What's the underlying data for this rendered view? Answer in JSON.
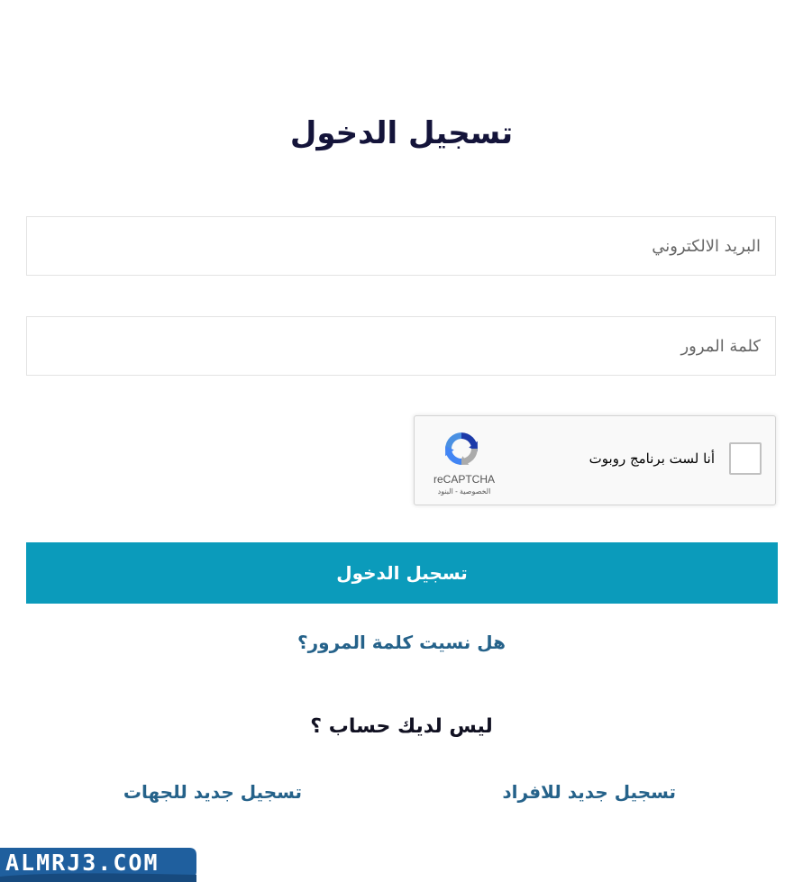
{
  "page": {
    "title": "تسجيل الدخول"
  },
  "form": {
    "email_placeholder": "البريد الالكتروني",
    "password_placeholder": "كلمة المرور",
    "login_button_label": "تسجيل الدخول"
  },
  "recaptcha": {
    "label": "أنا لست برنامج روبوت",
    "brand": "reCAPTCHA",
    "links": "الخصوصية - البنود",
    "logo_icon": "recaptcha-logo-icon",
    "checked": false
  },
  "links": {
    "forgot_password": "هل نسيت كلمة المرور؟",
    "no_account": "ليس لديك حساب ؟",
    "register_individuals": "تسجيل جديد للافراد",
    "register_entities": "تسجيل جديد للجهات"
  },
  "watermark": {
    "text": "ALMRJ3.COM"
  },
  "colors": {
    "accent": "#0b9bbb",
    "link": "#25628a",
    "title": "#14143a",
    "watermark_bg": "#1f5f9e"
  }
}
